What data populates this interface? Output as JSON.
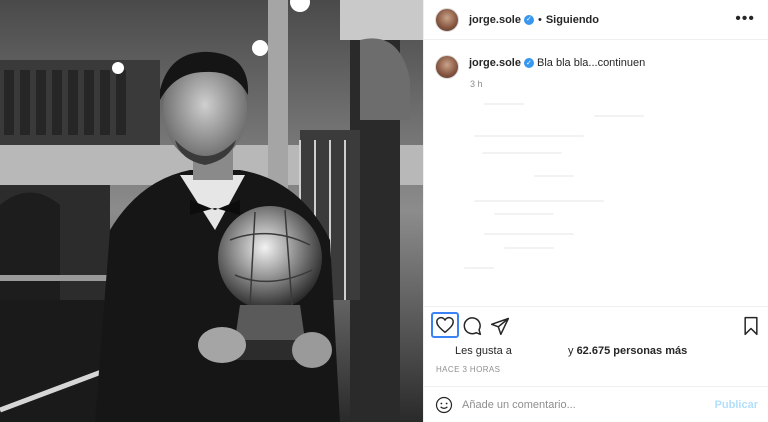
{
  "post": {
    "image_description": "black-and-white photo",
    "author": "jorge.sole",
    "verified": true,
    "follow_status": "Siguiendo",
    "separator": "•",
    "more_icon": "more-horizontal-icon"
  },
  "caption": {
    "username": "jorge.sole",
    "text": "Bla bla bla...continuen",
    "time_ago": "3 h"
  },
  "actions": {
    "like_icon": "heart-icon",
    "comment_icon": "comment-icon",
    "share_icon": "send-icon",
    "save_icon": "bookmark-icon"
  },
  "likes": {
    "prefix": "Les gusta a",
    "suffix_pre": "y ",
    "count_text": "62.675 personas más"
  },
  "posted_at": "HACE 3 HORAS",
  "comment_box": {
    "emoji_icon": "emoji-icon",
    "placeholder": "Añade un comentario...",
    "publish_label": "Publicar"
  },
  "colors": {
    "accent": "#3897f0",
    "publish_disabled": "#b2dffc",
    "like_focus": "#3b82f6"
  }
}
